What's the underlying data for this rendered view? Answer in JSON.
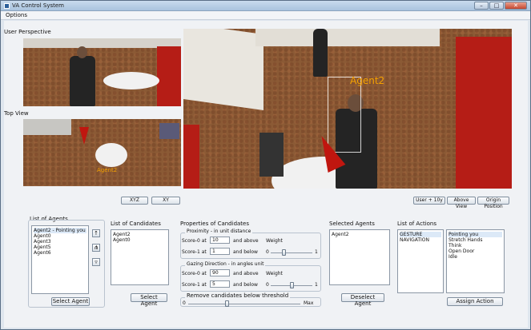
{
  "window": {
    "title": "VA Control System"
  },
  "menu": {
    "options": "Options"
  },
  "views": {
    "user_perspective": "User Perspective",
    "top_view": "Top View",
    "main_agent_label": "Agent2",
    "top_agent_label": "Agent2"
  },
  "buttons": {
    "xyz": "XYZ",
    "xy": "XY",
    "user_10y": "User + 10y",
    "above_view": "Above View",
    "origin_position": "Origin Position",
    "select_agent": "Select Agent",
    "select_candidate": "Select Agent",
    "deselect_agent": "Deselect Agent",
    "assign_action": "Assign Action"
  },
  "agents": {
    "title": "List of Agents",
    "items": [
      "Agent2 - Pointing you",
      "Agent0",
      "Agent3",
      "Agent5",
      "Agent6"
    ],
    "tool_icons": [
      "person-icon",
      "group-icon",
      "filter-icon"
    ]
  },
  "candidates": {
    "title": "List of Candidates",
    "items": [
      "Agent2",
      "Agent0"
    ]
  },
  "properties": {
    "title": "Properties of Candidates",
    "proximity": {
      "title": "Proximity - in unit distance",
      "score0_label": "Score-0 at",
      "score0_value": "10",
      "score0_suffix": "and above",
      "score1_label": "Score-1 at",
      "score1_value": "1",
      "score1_suffix": "and below",
      "weight_label": "Weight",
      "weight_min": "0",
      "weight_max": "1",
      "weight_value": 0.3
    },
    "gaze": {
      "title": "Gazing Direction - in angles unit",
      "score0_label": "Score-0 at",
      "score0_value": "90",
      "score0_suffix": "and above",
      "score1_label": "Score-1 at",
      "score1_value": "5",
      "score1_suffix": "and below",
      "weight_label": "Weight",
      "weight_min": "0",
      "weight_max": "1",
      "weight_value": 0.5
    },
    "threshold": {
      "title": "Remove candidates below threshold",
      "min": "0",
      "max": "Max",
      "value": 0.34
    }
  },
  "selected": {
    "title": "Selected Agents",
    "items": [
      "Agent2"
    ]
  },
  "actions": {
    "title": "List of Actions",
    "categories": [
      "GESTURE",
      "NAVIGATION"
    ],
    "items": [
      "Pointing you",
      "Stretch Hands",
      "Think",
      "Open Door",
      "Idle"
    ]
  },
  "colors": {
    "accent": "#f5a200",
    "red_cone": "#c0160f"
  }
}
